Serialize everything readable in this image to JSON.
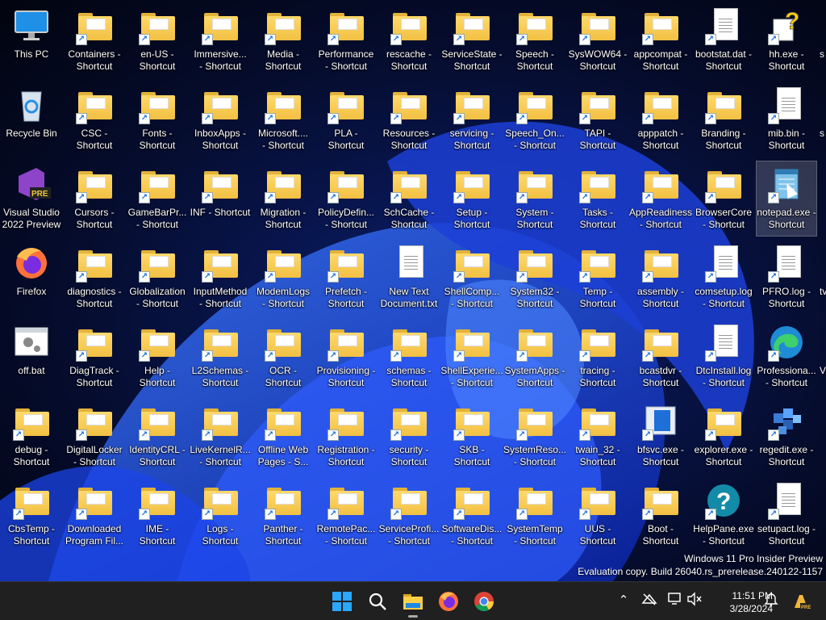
{
  "desktop": {
    "columns": [
      [
        {
          "label": "This PC",
          "icon": "this-pc-icon",
          "type": "pc"
        },
        {
          "label": "Recycle Bin",
          "icon": "recycle-bin-icon",
          "type": "bin"
        },
        {
          "label": "Visual Studio\n2022 Preview",
          "icon": "visual-studio-icon",
          "type": "vs"
        },
        {
          "label": "Firefox",
          "icon": "firefox-icon",
          "type": "firefox"
        },
        {
          "label": "off.bat",
          "icon": "batch-file-icon",
          "type": "bat"
        },
        {
          "label": "debug -\nShortcut",
          "icon": "folder-shortcut-icon",
          "type": "folder",
          "shortcut": true
        },
        {
          "label": "CbsTemp -\nShortcut",
          "icon": "folder-shortcut-icon",
          "type": "folder",
          "shortcut": true
        }
      ],
      [
        {
          "label": "Containers -\nShortcut",
          "icon": "folder-shortcut-icon",
          "type": "folder",
          "shortcut": true
        },
        {
          "label": "CSC -\nShortcut",
          "icon": "folder-shortcut-icon",
          "type": "folder",
          "shortcut": true
        },
        {
          "label": "Cursors -\nShortcut",
          "icon": "folder-shortcut-icon",
          "type": "folder",
          "shortcut": true
        },
        {
          "label": "diagnostics -\nShortcut",
          "icon": "folder-shortcut-icon",
          "type": "folder",
          "shortcut": true
        },
        {
          "label": "DiagTrack -\nShortcut",
          "icon": "folder-shortcut-icon",
          "type": "folder",
          "shortcut": true
        },
        {
          "label": "DigitalLocker\n- Shortcut",
          "icon": "folder-shortcut-icon",
          "type": "folder",
          "shortcut": true
        },
        {
          "label": "Downloaded\nProgram Fil...",
          "icon": "folder-shortcut-icon",
          "type": "folder",
          "shortcut": true
        }
      ],
      [
        {
          "label": "en-US -\nShortcut",
          "icon": "folder-shortcut-icon",
          "type": "folder",
          "shortcut": true
        },
        {
          "label": "Fonts -\nShortcut",
          "icon": "fonts-folder-icon",
          "type": "folder",
          "shortcut": true
        },
        {
          "label": "GameBarPr...\n- Shortcut",
          "icon": "folder-shortcut-icon",
          "type": "folder",
          "shortcut": true
        },
        {
          "label": "Globalization\n- Shortcut",
          "icon": "folder-shortcut-icon",
          "type": "folder",
          "shortcut": true
        },
        {
          "label": "Help -\nShortcut",
          "icon": "folder-shortcut-icon",
          "type": "folder",
          "shortcut": true
        },
        {
          "label": "IdentityCRL -\nShortcut",
          "icon": "folder-shortcut-icon",
          "type": "folder",
          "shortcut": true
        },
        {
          "label": "IME -\nShortcut",
          "icon": "folder-shortcut-icon",
          "type": "folder",
          "shortcut": true
        }
      ],
      [
        {
          "label": "Immersive...\n- Shortcut",
          "icon": "folder-shortcut-icon",
          "type": "folder",
          "shortcut": true
        },
        {
          "label": "InboxApps -\nShortcut",
          "icon": "folder-shortcut-icon",
          "type": "folder",
          "shortcut": true
        },
        {
          "label": "INF - Shortcut",
          "icon": "folder-shortcut-icon",
          "type": "folder",
          "shortcut": true
        },
        {
          "label": "InputMethod\n- Shortcut",
          "icon": "folder-shortcut-icon",
          "type": "folder",
          "shortcut": true
        },
        {
          "label": "L2Schemas -\nShortcut",
          "icon": "folder-shortcut-icon",
          "type": "folder",
          "shortcut": true
        },
        {
          "label": "LiveKernelR...\n- Shortcut",
          "icon": "folder-shortcut-icon",
          "type": "folder",
          "shortcut": true
        },
        {
          "label": "Logs -\nShortcut",
          "icon": "folder-shortcut-icon",
          "type": "folder",
          "shortcut": true
        }
      ],
      [
        {
          "label": "Media -\nShortcut",
          "icon": "folder-shortcut-icon",
          "type": "folder",
          "shortcut": true
        },
        {
          "label": "Microsoft....\n- Shortcut",
          "icon": "folder-shortcut-icon",
          "type": "folder",
          "shortcut": true
        },
        {
          "label": "Migration -\nShortcut",
          "icon": "folder-shortcut-icon",
          "type": "folder",
          "shortcut": true
        },
        {
          "label": "ModemLogs\n- Shortcut",
          "icon": "folder-shortcut-icon",
          "type": "folder",
          "shortcut": true
        },
        {
          "label": "OCR -\nShortcut",
          "icon": "folder-shortcut-icon",
          "type": "folder",
          "shortcut": true
        },
        {
          "label": "Offline Web\nPages - S...",
          "icon": "offline-web-pages-icon",
          "type": "folder",
          "shortcut": true
        },
        {
          "label": "Panther -\nShortcut",
          "icon": "folder-shortcut-icon",
          "type": "folder",
          "shortcut": true
        }
      ],
      [
        {
          "label": "Performance\n- Shortcut",
          "icon": "folder-shortcut-icon",
          "type": "folder",
          "shortcut": true
        },
        {
          "label": "PLA -\nShortcut",
          "icon": "folder-shortcut-icon",
          "type": "folder",
          "shortcut": true
        },
        {
          "label": "PolicyDefin...\n- Shortcut",
          "icon": "folder-shortcut-icon",
          "type": "folder",
          "shortcut": true
        },
        {
          "label": "Prefetch -\nShortcut",
          "icon": "folder-shortcut-icon",
          "type": "folder",
          "shortcut": true
        },
        {
          "label": "Provisioning -\nShortcut",
          "icon": "folder-shortcut-icon",
          "type": "folder",
          "shortcut": true
        },
        {
          "label": "Registration -\nShortcut",
          "icon": "folder-shortcut-icon",
          "type": "folder",
          "shortcut": true
        },
        {
          "label": "RemotePac...\n- Shortcut",
          "icon": "folder-shortcut-icon",
          "type": "folder",
          "shortcut": true
        }
      ],
      [
        {
          "label": "rescache -\nShortcut",
          "icon": "folder-shortcut-icon",
          "type": "folder",
          "shortcut": true
        },
        {
          "label": "Resources -\nShortcut",
          "icon": "folder-shortcut-icon",
          "type": "folder",
          "shortcut": true
        },
        {
          "label": "SchCache -\nShortcut",
          "icon": "folder-shortcut-icon",
          "type": "folder",
          "shortcut": true
        },
        {
          "label": "New Text\nDocument.txt",
          "icon": "text-file-icon",
          "type": "file"
        },
        {
          "label": "schemas -\nShortcut",
          "icon": "folder-shortcut-icon",
          "type": "folder",
          "shortcut": true
        },
        {
          "label": "security -\nShortcut",
          "icon": "folder-shortcut-icon",
          "type": "folder",
          "shortcut": true
        },
        {
          "label": "ServiceProfi...\n- Shortcut",
          "icon": "folder-shortcut-icon",
          "type": "folder",
          "shortcut": true
        }
      ],
      [
        {
          "label": "ServiceState -\nShortcut",
          "icon": "folder-shortcut-icon",
          "type": "folder",
          "shortcut": true
        },
        {
          "label": "servicing -\nShortcut",
          "icon": "folder-shortcut-icon",
          "type": "folder",
          "shortcut": true
        },
        {
          "label": "Setup -\nShortcut",
          "icon": "folder-shortcut-icon",
          "type": "folder",
          "shortcut": true
        },
        {
          "label": "ShellComp...\n- Shortcut",
          "icon": "folder-shortcut-icon",
          "type": "folder",
          "shortcut": true
        },
        {
          "label": "ShellExperie...\n- Shortcut",
          "icon": "folder-shortcut-icon",
          "type": "folder",
          "shortcut": true
        },
        {
          "label": "SKB -\nShortcut",
          "icon": "folder-shortcut-icon",
          "type": "folder",
          "shortcut": true
        },
        {
          "label": "SoftwareDis...\n- Shortcut",
          "icon": "folder-shortcut-icon",
          "type": "folder",
          "shortcut": true
        }
      ],
      [
        {
          "label": "Speech -\nShortcut",
          "icon": "folder-shortcut-icon",
          "type": "folder",
          "shortcut": true
        },
        {
          "label": "Speech_On...\n- Shortcut",
          "icon": "folder-shortcut-icon",
          "type": "folder",
          "shortcut": true
        },
        {
          "label": "System -\nShortcut",
          "icon": "folder-shortcut-icon",
          "type": "folder",
          "shortcut": true
        },
        {
          "label": "System32 -\nShortcut",
          "icon": "folder-shortcut-icon",
          "type": "folder",
          "shortcut": true
        },
        {
          "label": "SystemApps -\nShortcut",
          "icon": "folder-shortcut-icon",
          "type": "folder",
          "shortcut": true
        },
        {
          "label": "SystemReso...\n- Shortcut",
          "icon": "folder-shortcut-icon",
          "type": "folder",
          "shortcut": true
        },
        {
          "label": "SystemTemp\n- Shortcut",
          "icon": "folder-shortcut-icon",
          "type": "folder",
          "shortcut": true
        }
      ],
      [
        {
          "label": "SysWOW64 -\nShortcut",
          "icon": "folder-shortcut-icon",
          "type": "folder",
          "shortcut": true
        },
        {
          "label": "TAPI -\nShortcut",
          "icon": "folder-shortcut-icon",
          "type": "folder",
          "shortcut": true
        },
        {
          "label": "Tasks -\nShortcut",
          "icon": "folder-shortcut-icon",
          "type": "folder",
          "shortcut": true
        },
        {
          "label": "Temp -\nShortcut",
          "icon": "folder-shortcut-icon",
          "type": "folder",
          "shortcut": true
        },
        {
          "label": "tracing -\nShortcut",
          "icon": "folder-shortcut-icon",
          "type": "folder",
          "shortcut": true
        },
        {
          "label": "twain_32 -\nShortcut",
          "icon": "folder-shortcut-icon",
          "type": "folder",
          "shortcut": true
        },
        {
          "label": "UUS -\nShortcut",
          "icon": "folder-shortcut-icon",
          "type": "folder",
          "shortcut": true
        }
      ],
      [
        {
          "label": "appcompat -\nShortcut",
          "icon": "folder-shortcut-icon",
          "type": "folder",
          "shortcut": true
        },
        {
          "label": "apppatch -\nShortcut",
          "icon": "folder-shortcut-icon",
          "type": "folder",
          "shortcut": true
        },
        {
          "label": "AppReadiness\n- Shortcut",
          "icon": "folder-shortcut-icon",
          "type": "folder",
          "shortcut": true
        },
        {
          "label": "assembly -\nShortcut",
          "icon": "folder-shortcut-icon",
          "type": "folder",
          "shortcut": true
        },
        {
          "label": "bcastdvr -\nShortcut",
          "icon": "folder-shortcut-icon",
          "type": "folder",
          "shortcut": true
        },
        {
          "label": "bfsvc.exe -\nShortcut",
          "icon": "exe-shortcut-icon",
          "type": "exe",
          "shortcut": true
        },
        {
          "label": "Boot -\nShortcut",
          "icon": "folder-shortcut-icon",
          "type": "folder",
          "shortcut": true
        }
      ],
      [
        {
          "label": "bootstat.dat -\nShortcut",
          "icon": "file-shortcut-icon",
          "type": "file",
          "shortcut": true
        },
        {
          "label": "Branding -\nShortcut",
          "icon": "folder-shortcut-icon",
          "type": "folder",
          "shortcut": true
        },
        {
          "label": "BrowserCore\n- Shortcut",
          "icon": "folder-shortcut-icon",
          "type": "folder",
          "shortcut": true
        },
        {
          "label": "comsetup.log\n- Shortcut",
          "icon": "file-shortcut-icon",
          "type": "file",
          "shortcut": true
        },
        {
          "label": "DtcInstall.log\n- Shortcut",
          "icon": "file-shortcut-icon",
          "type": "file",
          "shortcut": true
        },
        {
          "label": "explorer.exe -\nShortcut",
          "icon": "explorer-icon",
          "type": "folder",
          "shortcut": true
        },
        {
          "label": "HelpPane.exe\n- Shortcut",
          "icon": "help-icon",
          "type": "help",
          "shortcut": true
        }
      ],
      [
        {
          "label": "hh.exe -\nShortcut",
          "icon": "help-file-icon",
          "type": "hh",
          "shortcut": true
        },
        {
          "label": "mib.bin -\nShortcut",
          "icon": "file-shortcut-icon",
          "type": "file",
          "shortcut": true
        },
        {
          "label": "notepad.exe -\nShortcut",
          "icon": "notepad-icon",
          "type": "notepad",
          "shortcut": true,
          "selected": true
        },
        {
          "label": "PFRO.log -\nShortcut",
          "icon": "file-shortcut-icon",
          "type": "file",
          "shortcut": true
        },
        {
          "label": "Professiona...\n- Shortcut",
          "icon": "edge-icon",
          "type": "edge",
          "shortcut": true
        },
        {
          "label": "regedit.exe -\nShortcut",
          "icon": "regedit-icon",
          "type": "regedit",
          "shortcut": true
        },
        {
          "label": "setupact.log -\nShortcut",
          "icon": "file-shortcut-icon",
          "type": "file",
          "shortcut": true
        }
      ]
    ],
    "cutoff_labels": [
      "s",
      "s",
      "",
      "tv",
      "V",
      "",
      ""
    ]
  },
  "watermark": {
    "line1": "Windows 11 Pro Insider Preview",
    "line2": "Evaluation copy. Build 26040.rs_prerelease.240122-1157"
  },
  "taskbar": {
    "apps": [
      {
        "name": "start-button",
        "icon": "windows-logo-icon"
      },
      {
        "name": "search-button",
        "icon": "search-icon"
      },
      {
        "name": "file-explorer-button",
        "icon": "file-explorer-icon"
      },
      {
        "name": "firefox-taskbar-button",
        "icon": "firefox-icon"
      },
      {
        "name": "chrome-taskbar-button",
        "icon": "chrome-icon"
      }
    ],
    "time": "11:51 PM",
    "date": "3/28/2024"
  },
  "colors": {
    "taskbar_bg": "#202020",
    "folder_yellow": "#f2c043",
    "wallpaper_blue": "#1f4fe0"
  }
}
